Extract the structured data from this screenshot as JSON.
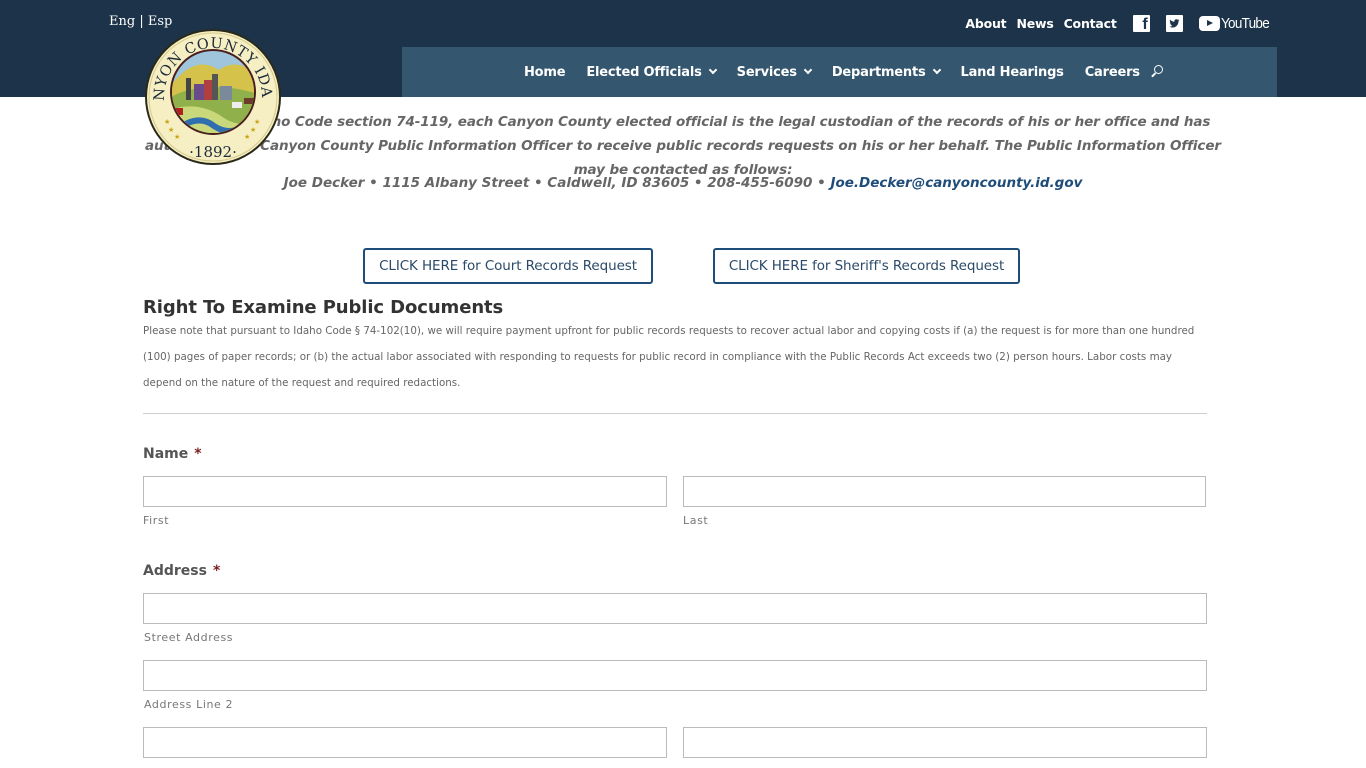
{
  "header": {
    "lang": {
      "eng": "Eng",
      "sep": "|",
      "esp": "Esp"
    },
    "utility_links": [
      "About",
      "News",
      "Contact"
    ],
    "social": {
      "facebook": "facebook-icon",
      "twitter": "twitter-icon",
      "youtube_label": "YouTube"
    },
    "logo": {
      "top_text": "CANYON COUNTY IDAHO",
      "year": "·1892·"
    },
    "nav": [
      {
        "label": "Home",
        "dropdown": false
      },
      {
        "label": "Elected Officials",
        "dropdown": true
      },
      {
        "label": "Services",
        "dropdown": true
      },
      {
        "label": "Departments",
        "dropdown": true
      },
      {
        "label": "Land Hearings",
        "dropdown": false
      },
      {
        "label": "Careers",
        "dropdown": false
      }
    ],
    "search_icon": "search-icon"
  },
  "intro": {
    "text": "Pursuant to Idaho Code section 74-119, each Canyon County elected official is the legal custodian of the records of his or her office and has authorized the Canyon County Public Information Officer to receive public records requests on his or her behalf. The Public Information Officer may be contacted as follows:",
    "contact": "Joe Decker • 1115 Albany Street • Caldwell, ID 83605 • 208-455-6090 • ",
    "email": "Joe.Decker@canyoncounty.id.gov"
  },
  "buttons": {
    "court": "CLICK HERE for Court Records Request",
    "sheriff": "CLICK HERE for Sheriff's Records Request"
  },
  "section": {
    "title": "Right To Examine Public Documents",
    "body": "Please note that pursuant to Idaho Code § 74-102(10), we will require payment upfront for public records requests to recover actual labor and copying costs if (a) the request is for more than one hundred (100) pages of paper records; or (b) the actual labor associated with responding to requests for public record in compliance with the Public Records Act exceeds two (2) person hours. Labor costs may depend on the nature of the request and required redactions."
  },
  "form": {
    "name": {
      "label": "Name",
      "required": "*",
      "first": {
        "sublabel": "First",
        "value": ""
      },
      "last": {
        "sublabel": "Last",
        "value": ""
      }
    },
    "address": {
      "label": "Address",
      "required": "*",
      "street": {
        "sublabel": "Street Address",
        "value": ""
      },
      "line2": {
        "sublabel": "Address Line 2",
        "value": ""
      },
      "city": {
        "value": ""
      },
      "state": {
        "value": ""
      }
    }
  },
  "colors": {
    "topbar": "#1d3349",
    "navbar": "#34566f",
    "accent": "#1f4d7a",
    "required": "#7a1f1f"
  }
}
